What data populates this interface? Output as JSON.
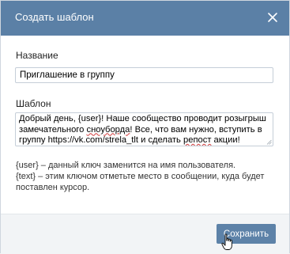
{
  "dialog": {
    "title": "Создать шаблон",
    "close_icon": "close-icon"
  },
  "form": {
    "name_label": "Название",
    "name_value": "Приглашение в группу",
    "template_label": "Шаблон",
    "template_text": {
      "part1": "Добрый день, {user}! Наше сообщество проводит розыгрыш замечательного ",
      "misspelled1": "сноуборда",
      "part2": "! Все, что вам нужно, вступить в группу https://vk.com/strela_tlt и сделать ",
      "misspelled2": "репост",
      "part3": " акции!"
    }
  },
  "hints": {
    "line1": "{user} – данный ключ заменится на имя пользователя.",
    "line2": "{text} – этим ключом отметьте место в сообщении, куда будет поставлен курсор."
  },
  "footer": {
    "save_label": "Сохранить"
  },
  "colors": {
    "header": "#5b80a6",
    "button": "#5d82a8",
    "footer": "#f2f4f6"
  }
}
